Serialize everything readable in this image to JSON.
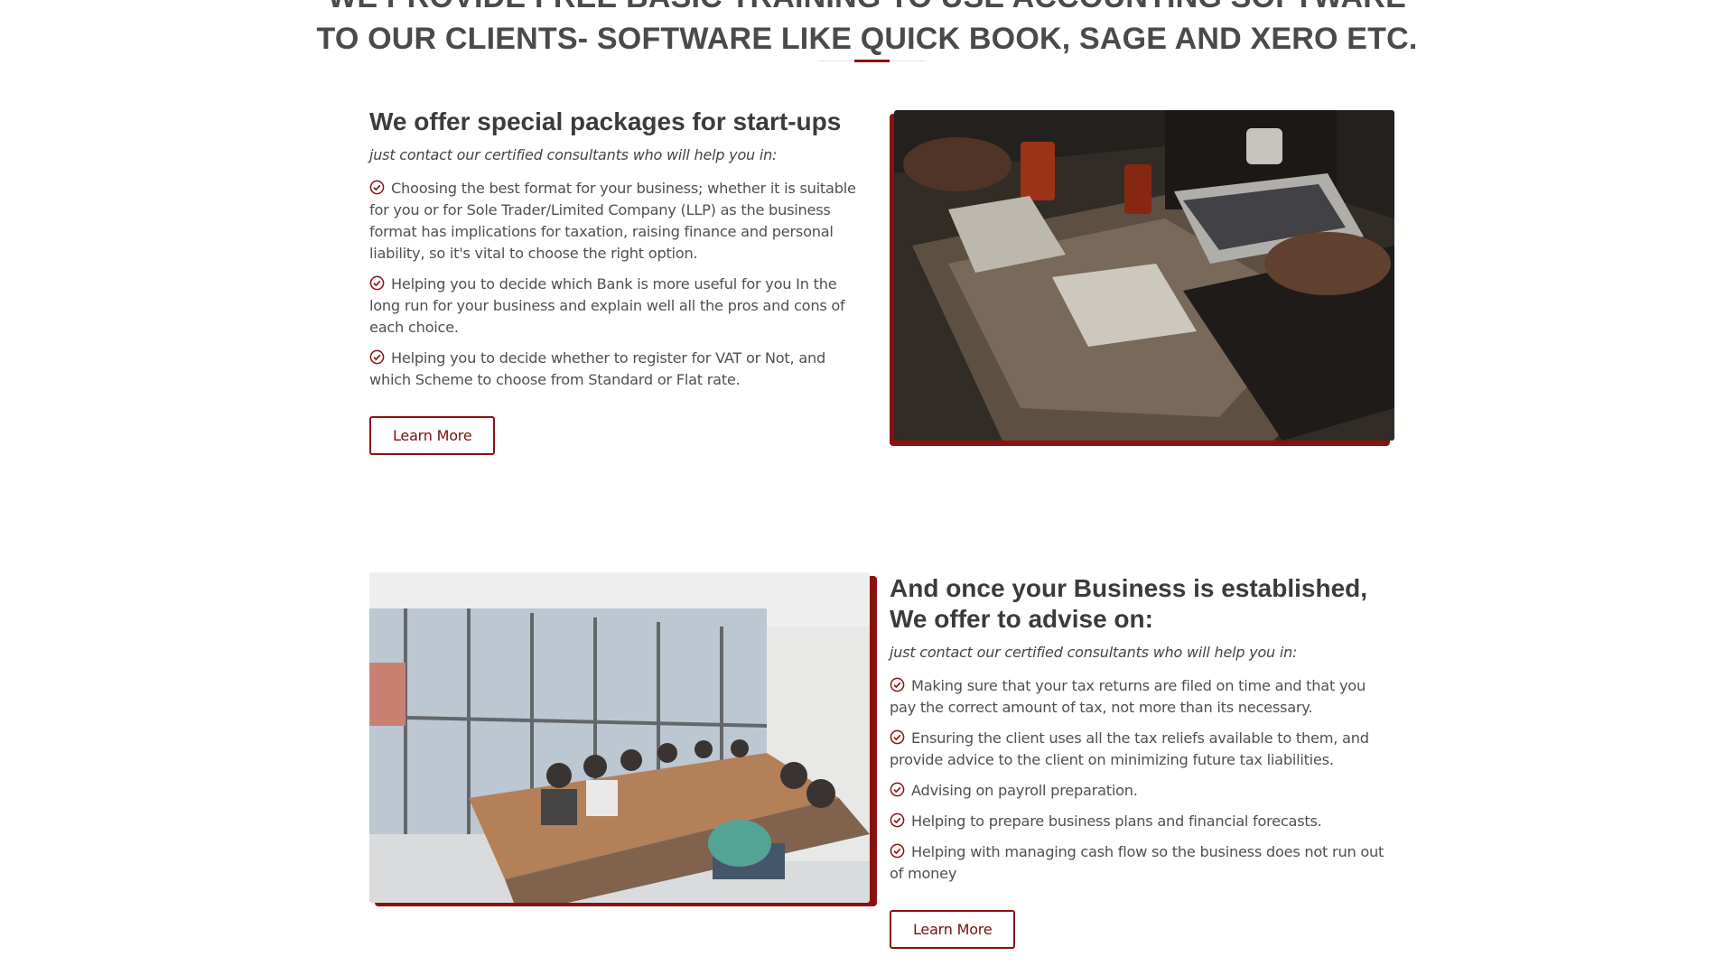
{
  "top_section": {
    "heading_line1": "WE PROVIDE FREE BASIC TRAINING TO USE ACCOUNTING SOFTWARE",
    "heading_line2": "TO OUR CLIENTS- SOFTWARE LIKE QUICK BOOK, SAGE AND XERO ETC."
  },
  "startups": {
    "title": "We offer special packages for start-ups",
    "subtitle": "just contact our certified consultants who will help you in:",
    "items": [
      "Choosing the best format for your business; whether it is suitable for you or for Sole Trader/Limited Company (LLP) as the business format has implications for taxation, raising finance and personal liability, so it's vital to choose the right option.",
      "Helping you to decide which Bank is more useful for you In the long run for your business and explain well all the pros and cons of each choice.",
      "Helping you to decide whether to register for VAT or Not, and which Scheme to choose from Standard or Flat rate."
    ],
    "button_label": "Learn More"
  },
  "established": {
    "title_line1": "And once your Business is established,",
    "title_line2": "We offer to advise on:",
    "subtitle": "just contact our certified consultants who will help you in:",
    "items": [
      "Making sure that your tax returns are filed on time and that you pay the correct amount of tax, not more than its necessary.",
      "Ensuring the client uses all the tax reliefs available to them, and provide advice to the client on minimizing future tax liabilities.",
      "Advising on payroll preparation.",
      "Helping to prepare business plans and financial forecasts.",
      "Helping with managing cash flow so the business does not run out of money"
    ],
    "button_label": "Learn More"
  },
  "icons": {
    "list_bullet": "check-circle-icon"
  },
  "colors": {
    "accent": "#8b1111",
    "heading": "#3b3b3b",
    "body_text": "#505050"
  }
}
